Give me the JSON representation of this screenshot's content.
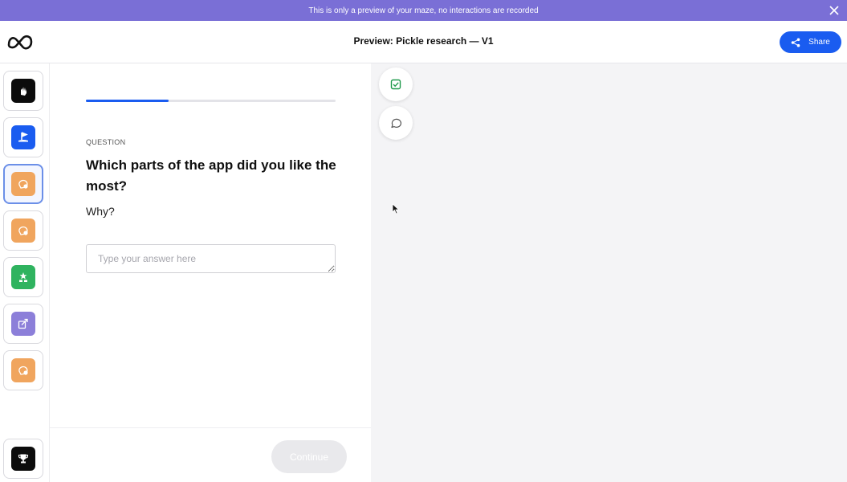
{
  "banner": {
    "text": "This is only a preview of your maze, no interactions are recorded"
  },
  "header": {
    "title": "Preview: Pickle research — V1",
    "share_label": "Share"
  },
  "sidebar": {
    "steps": [
      {
        "icon": "mission-icon",
        "color": "#0c0c0c"
      },
      {
        "icon": "flag-icon",
        "color": "#1a5cf0"
      },
      {
        "icon": "open-question-icon",
        "color": "#f0a55e",
        "active": true
      },
      {
        "icon": "open-question-icon",
        "color": "#f0a55e"
      },
      {
        "icon": "opinion-scale-icon",
        "color": "#2fb35f"
      },
      {
        "icon": "card-sort-icon",
        "color": "#8c7fd9"
      },
      {
        "icon": "open-question-icon",
        "color": "#f0a55e"
      },
      {
        "icon": "trophy-icon",
        "color": "#0c0c0c"
      }
    ]
  },
  "main": {
    "progress": 0.33,
    "question_label": "QUESTION",
    "question_title": "Which parts of the app did you like the most?",
    "question_subtitle": "Why?",
    "answer_placeholder": "Type your answer here",
    "continue_label": "Continue"
  },
  "colors": {
    "accent": "#1a5cf0",
    "banner": "#7a6fd6"
  }
}
